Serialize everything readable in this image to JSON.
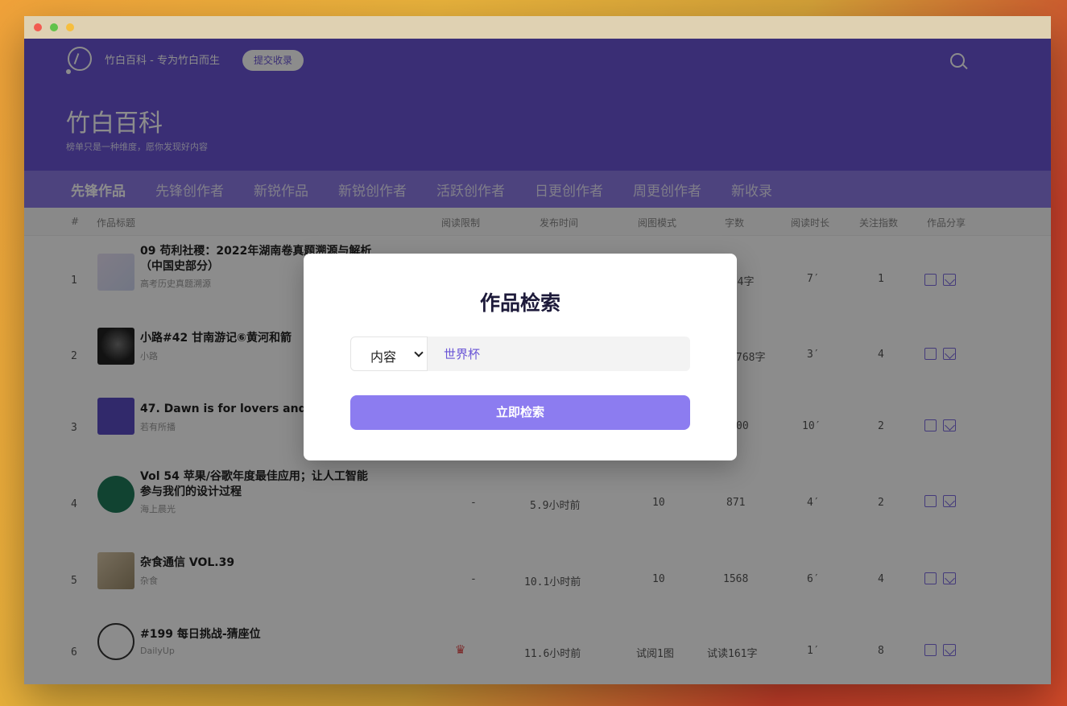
{
  "window": {
    "dots": [
      "red",
      "green",
      "yellow"
    ]
  },
  "header": {
    "site_name": "竹白百科 - 专为竹白而生",
    "submit_label": "提交收录",
    "title": "竹白百科",
    "subtitle": "榜单只是一种维度，愿你发现好内容"
  },
  "tabs": [
    {
      "label": "先锋作品",
      "active": true
    },
    {
      "label": "先锋创作者"
    },
    {
      "label": "新锐作品"
    },
    {
      "label": "新锐创作者"
    },
    {
      "label": "活跃创作者"
    },
    {
      "label": "日更创作者"
    },
    {
      "label": "周更创作者"
    },
    {
      "label": "新收录"
    }
  ],
  "table": {
    "columns": [
      "#",
      "作品标题",
      "阅读限制",
      "发布时间",
      "阅图模式",
      "字数",
      "阅读时长",
      "关注指数",
      "作品分享"
    ],
    "rows": [
      {
        "rank": "1",
        "title_line1": "09 苟利社稷：2022年湖南卷真题溯源与解析",
        "title_line2": "（中国史部分）",
        "author": "高考历史真题溯源",
        "limit": "",
        "time": "",
        "mode": "",
        "words": "874字",
        "duration": "7′",
        "index": "1"
      },
      {
        "rank": "2",
        "title_line1": "小路#42 甘南游记⑥黄河和箭",
        "title_line2": "",
        "author": "小路",
        "limit": "",
        "time": "",
        "mode": "",
        "words": "768字",
        "duration": "3′",
        "index": "4"
      },
      {
        "rank": "3",
        "title_line1": "47. Dawn is for lovers and b",
        "title_line2": "",
        "author": "若有所播",
        "limit": "",
        "time": "",
        "mode": "",
        "words": "00",
        "duration": "10′",
        "index": "2"
      },
      {
        "rank": "4",
        "title_line1": "Vol 54 苹果/谷歌年度最佳应用；让人工智能",
        "title_line2": "参与我们的设计过程",
        "author": "海上晨光",
        "limit": "-",
        "time": "5.9小时前",
        "mode": "10",
        "words": "871",
        "duration": "4′",
        "index": "2"
      },
      {
        "rank": "5",
        "title_line1": "杂食通信 VOL.39",
        "title_line2": "",
        "author": "杂食",
        "limit": "-",
        "time": "10.1小时前",
        "mode": "10",
        "words": "1568",
        "duration": "6′",
        "index": "4"
      },
      {
        "rank": "6",
        "title_line1": "#199 每日挑战-猜座位",
        "title_line2": "",
        "author": "DailyUp",
        "limit": "♛",
        "time": "11.6小时前",
        "mode": "试阅1图",
        "words": "试读161字",
        "duration": "1′",
        "index": "8"
      }
    ]
  },
  "modal": {
    "title": "作品检索",
    "select_value": "内容",
    "query_value": "世界杯",
    "search_label": "立即检索"
  },
  "colors": {
    "brand": "#6a55d6",
    "accent": "#8c7cf0",
    "vip": "#e14a4a"
  }
}
